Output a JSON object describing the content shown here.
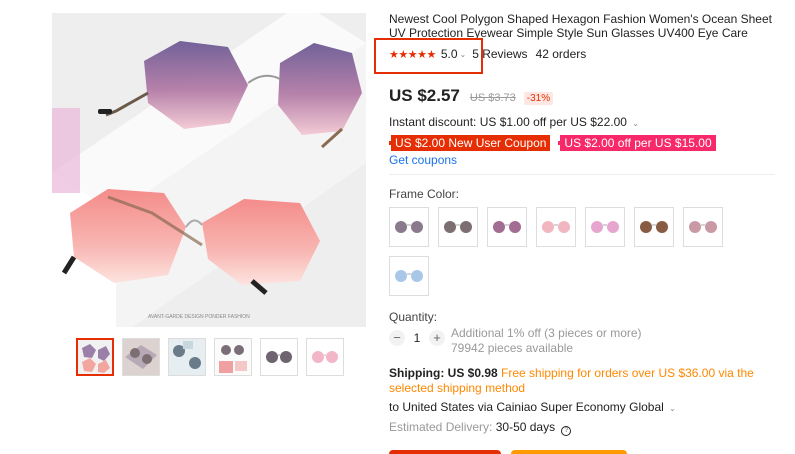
{
  "product": {
    "title": "Newest Cool Polygon Shaped Hexagon Fashion Women's Ocean Sheet UV Protection Eyewear Simple Style Sun Glasses UV400 Eye Care",
    "stars": "★★★★★",
    "rating": "5.0",
    "reviews": "5 Reviews",
    "orders": "42 orders",
    "price": "US $2.57",
    "old_price": "US $3.73",
    "discount": "-31%",
    "instant_discount": "Instant discount: US $1.00 off per US $22.00",
    "coupons": [
      "US $2.00 New User Coupon",
      "US $2.00 off per US $15.00"
    ],
    "get_coupons": "Get coupons"
  },
  "gallery": {
    "watermark": "AVANT-GARDE DESIGN PONDER FASHION"
  },
  "options": {
    "frame_color_label": "Frame Color:",
    "swatches": [
      {
        "name": "grey-purple",
        "lens": "#8a7a8e"
      },
      {
        "name": "grey-brown",
        "lens": "#7d6e72"
      },
      {
        "name": "purple-pink",
        "lens": "#a36c92"
      },
      {
        "name": "pink-light",
        "lens": "#f2b6c1"
      },
      {
        "name": "pink-purple",
        "lens": "#e7a6cf"
      },
      {
        "name": "brown",
        "lens": "#8a5b44"
      },
      {
        "name": "pink-grey",
        "lens": "#c99aa6"
      },
      {
        "name": "blue",
        "lens": "#a9c8e8"
      }
    ]
  },
  "quantity": {
    "label": "Quantity:",
    "value": "1",
    "minus": "−",
    "plus": "+",
    "extra": "Additional 1% off (3 pieces or more)",
    "available": "79942 pieces available"
  },
  "shipping": {
    "label": "Shipping: US $0.98",
    "free": "Free shipping for orders over US $36.00 via the selected shipping method",
    "to": "to United States via Cainiao Super Economy Global",
    "delivery_label": "Estimated Delivery:",
    "delivery_value": "30-50 days"
  },
  "colors": {
    "accent": "#e62e04",
    "pink": "#f7296b",
    "orange": "#ff8800",
    "link": "#1a73e8"
  }
}
